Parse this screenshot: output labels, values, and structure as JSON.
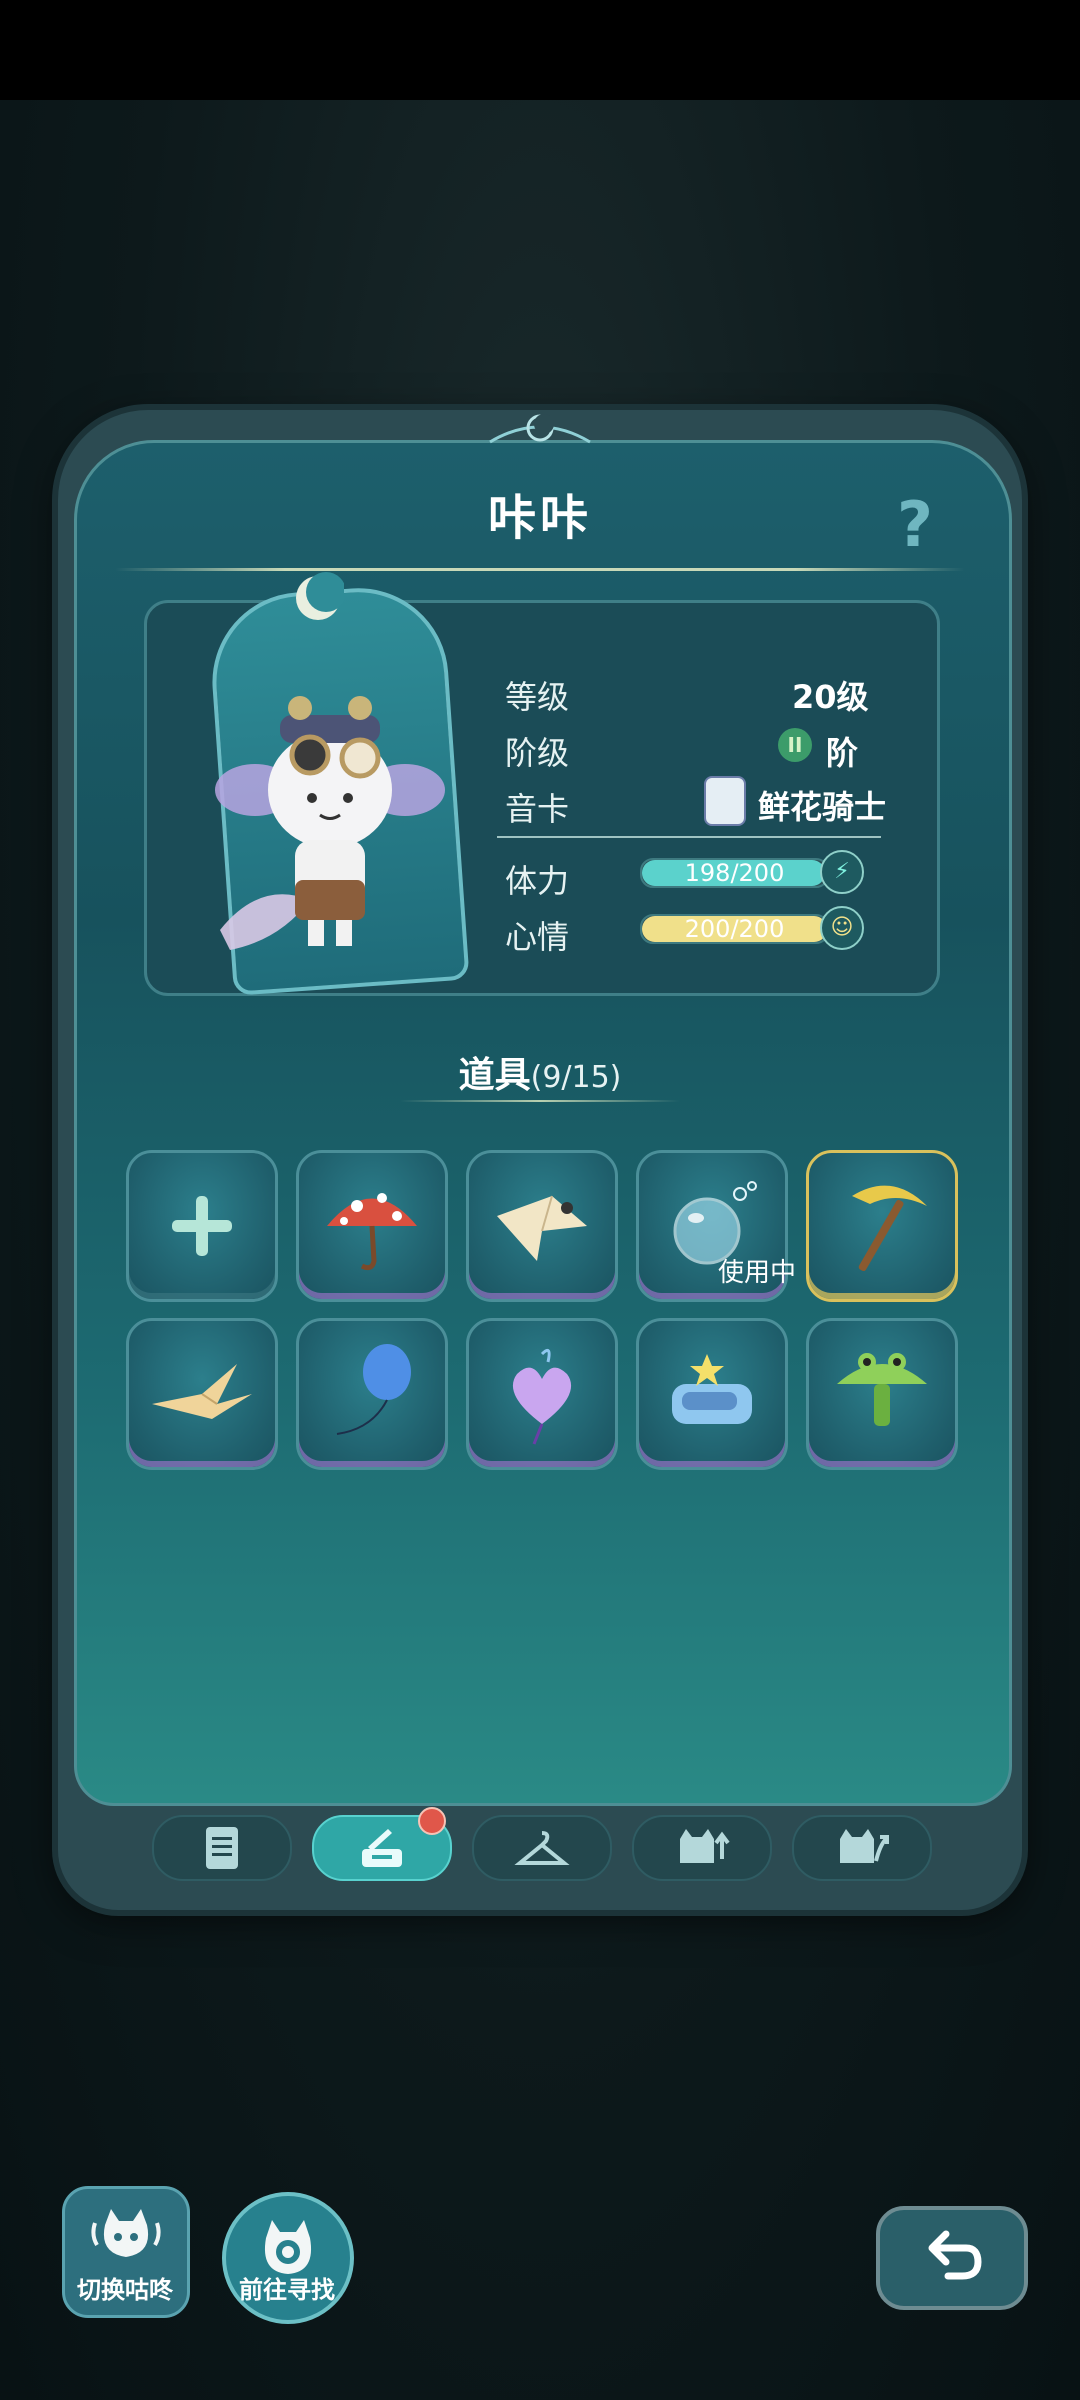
{
  "character": {
    "name": "咔咔",
    "help_symbol": "?"
  },
  "stats": {
    "level_label": "等级",
    "level_value": "20级",
    "rank_label": "阶级",
    "rank_badge": "II",
    "rank_value": "阶",
    "card_label": "音卡",
    "card_value": "鲜花骑士",
    "stamina_label": "体力",
    "stamina_text": "198/200",
    "stamina_fraction": 0.99,
    "mood_label": "心情",
    "mood_text": "200/200",
    "mood_fraction": 1.0
  },
  "items_section": {
    "title": "道具",
    "count": "(9/15)",
    "in_use_label": "使用中",
    "slots": [
      {
        "icon": "plus-icon"
      },
      {
        "icon": "mushroom-umbrella-icon"
      },
      {
        "icon": "paper-kite-icon"
      },
      {
        "icon": "bubble-icon"
      },
      {
        "icon": "pickaxe-icon"
      },
      {
        "icon": "paper-crane-icon"
      },
      {
        "icon": "blue-balloon-icon"
      },
      {
        "icon": "heart-balloon-icon"
      },
      {
        "icon": "star-bed-icon"
      },
      {
        "icon": "frog-umbrella-icon"
      }
    ]
  },
  "tabs": [
    {
      "icon": "clipboard-icon"
    },
    {
      "icon": "tools-icon",
      "active": true,
      "notification": true
    },
    {
      "icon": "hanger-icon"
    },
    {
      "icon": "cat-up-icon"
    },
    {
      "icon": "cat-evolve-icon"
    }
  ],
  "controls": {
    "switch_label": "切换咕咚",
    "find_label": "前往寻找"
  },
  "colors": {
    "panel": "#1d5f6c",
    "stamina_bar": "#5bd2cc",
    "mood_bar": "#f0e08a",
    "active_tab": "#2fa7a6",
    "notification": "#e0574a"
  }
}
